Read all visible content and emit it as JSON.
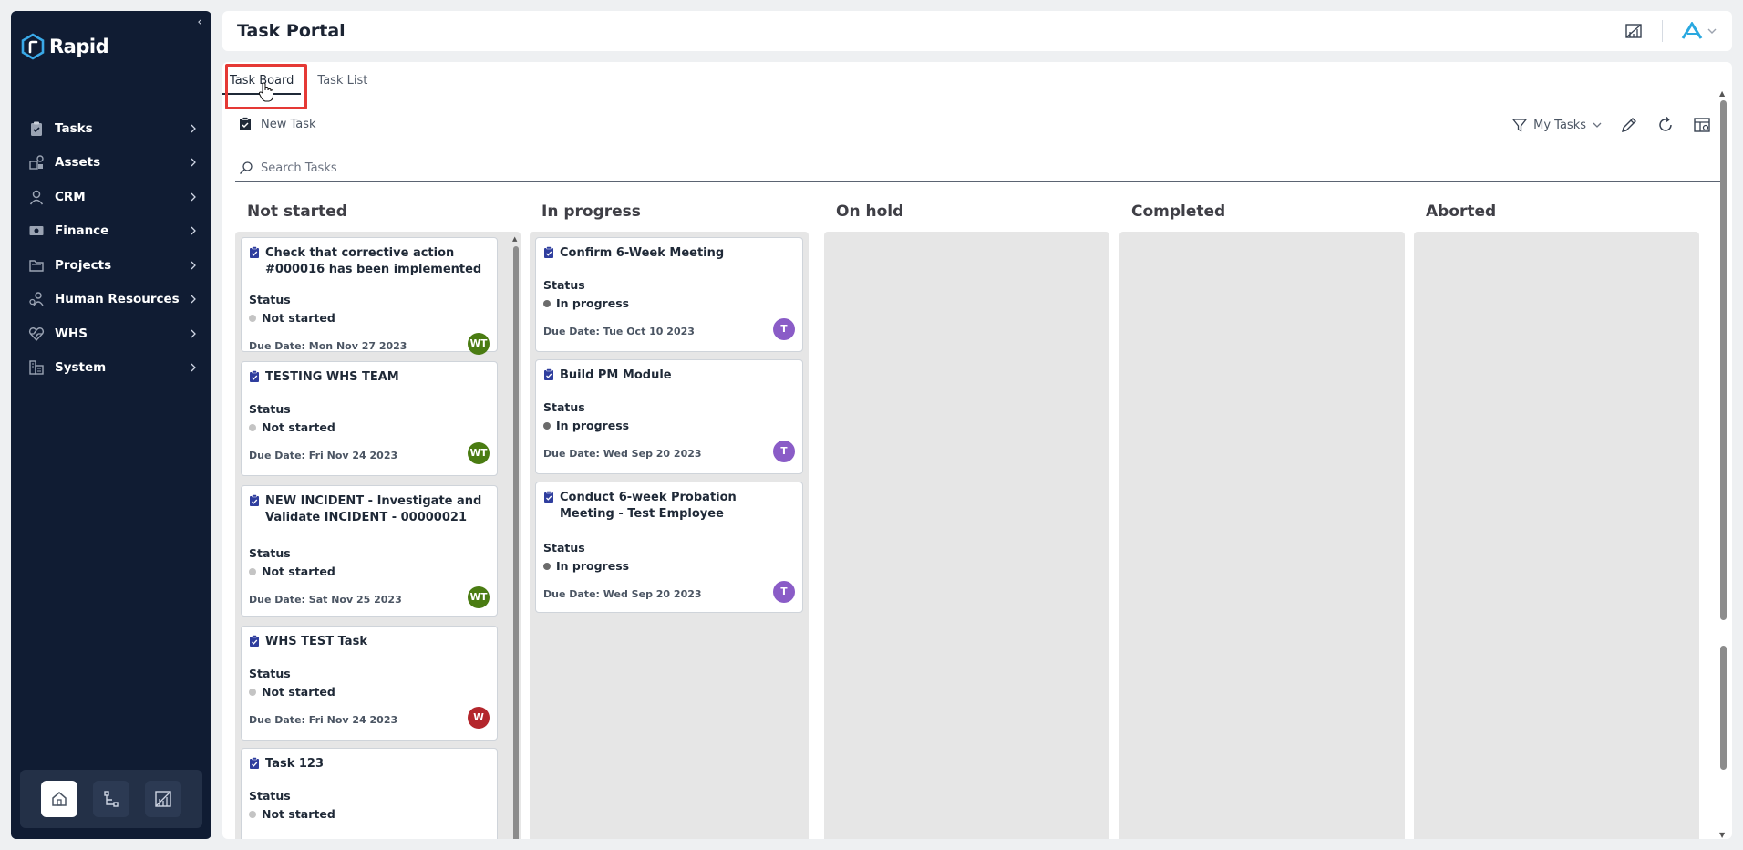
{
  "app": {
    "logo_text": "Rapid",
    "title": "Task Portal"
  },
  "sidebar": {
    "items": [
      {
        "label": "Tasks",
        "icon": "clipboard-icon"
      },
      {
        "label": "Assets",
        "icon": "assets-icon"
      },
      {
        "label": "CRM",
        "icon": "user-icon"
      },
      {
        "label": "Finance",
        "icon": "money-icon"
      },
      {
        "label": "Projects",
        "icon": "folder-icon"
      },
      {
        "label": "Human Resources",
        "icon": "people-icon"
      },
      {
        "label": "WHS",
        "icon": "heartbeat-icon"
      },
      {
        "label": "System",
        "icon": "system-icon"
      }
    ],
    "tray": [
      "home-icon",
      "workflow-icon",
      "report-icon"
    ]
  },
  "tabs": [
    {
      "label": "Task Board",
      "active": true
    },
    {
      "label": "Task List",
      "active": false
    }
  ],
  "toolbar": {
    "new_task_label": "New Task",
    "filter_label": "My Tasks",
    "search_placeholder": "Search Tasks"
  },
  "colors": {
    "sidebar_bg": "#101c33",
    "highlight": "#e53935",
    "avatar_green": "#4a7c12",
    "avatar_red": "#b3262c",
    "avatar_purple": "#8a5cc7",
    "dot_not_started": "#c4c4c4",
    "dot_in_progress": "#6b6b6b"
  },
  "board": {
    "status_label": "Status",
    "due_prefix": "Due Date:",
    "columns": [
      {
        "title": "Not started",
        "cards": [
          {
            "title": "Check that corrective action #000016 has been implemented",
            "status": "Not started",
            "due": "Mon Nov 27 2023",
            "assignee": "WT"
          },
          {
            "title": "TESTING WHS TEAM",
            "status": "Not started",
            "due": "Fri Nov 24 2023",
            "assignee": "WT"
          },
          {
            "title": "NEW INCIDENT - Investigate and Validate INCIDENT - 00000021",
            "status": "Not started",
            "due": "Sat Nov 25 2023",
            "assignee": "WT"
          },
          {
            "title": "WHS TEST Task",
            "status": "Not started",
            "due": "Fri Nov 24 2023",
            "assignee": "W"
          },
          {
            "title": "Task 123",
            "status": "Not started",
            "due": "",
            "assignee": ""
          }
        ]
      },
      {
        "title": "In progress",
        "cards": [
          {
            "title": "Confirm 6-Week Meeting",
            "status": "In progress",
            "due": "Tue Oct 10 2023",
            "assignee": "T"
          },
          {
            "title": "Build PM Module",
            "status": "In progress",
            "due": "Wed Sep 20 2023",
            "assignee": "T"
          },
          {
            "title": "Conduct 6-week Probation Meeting - Test Employee",
            "status": "In progress",
            "due": "Wed Sep 20 2023",
            "assignee": "T"
          }
        ]
      },
      {
        "title": "On hold",
        "cards": []
      },
      {
        "title": "Completed",
        "cards": []
      },
      {
        "title": "Aborted",
        "cards": []
      }
    ]
  }
}
